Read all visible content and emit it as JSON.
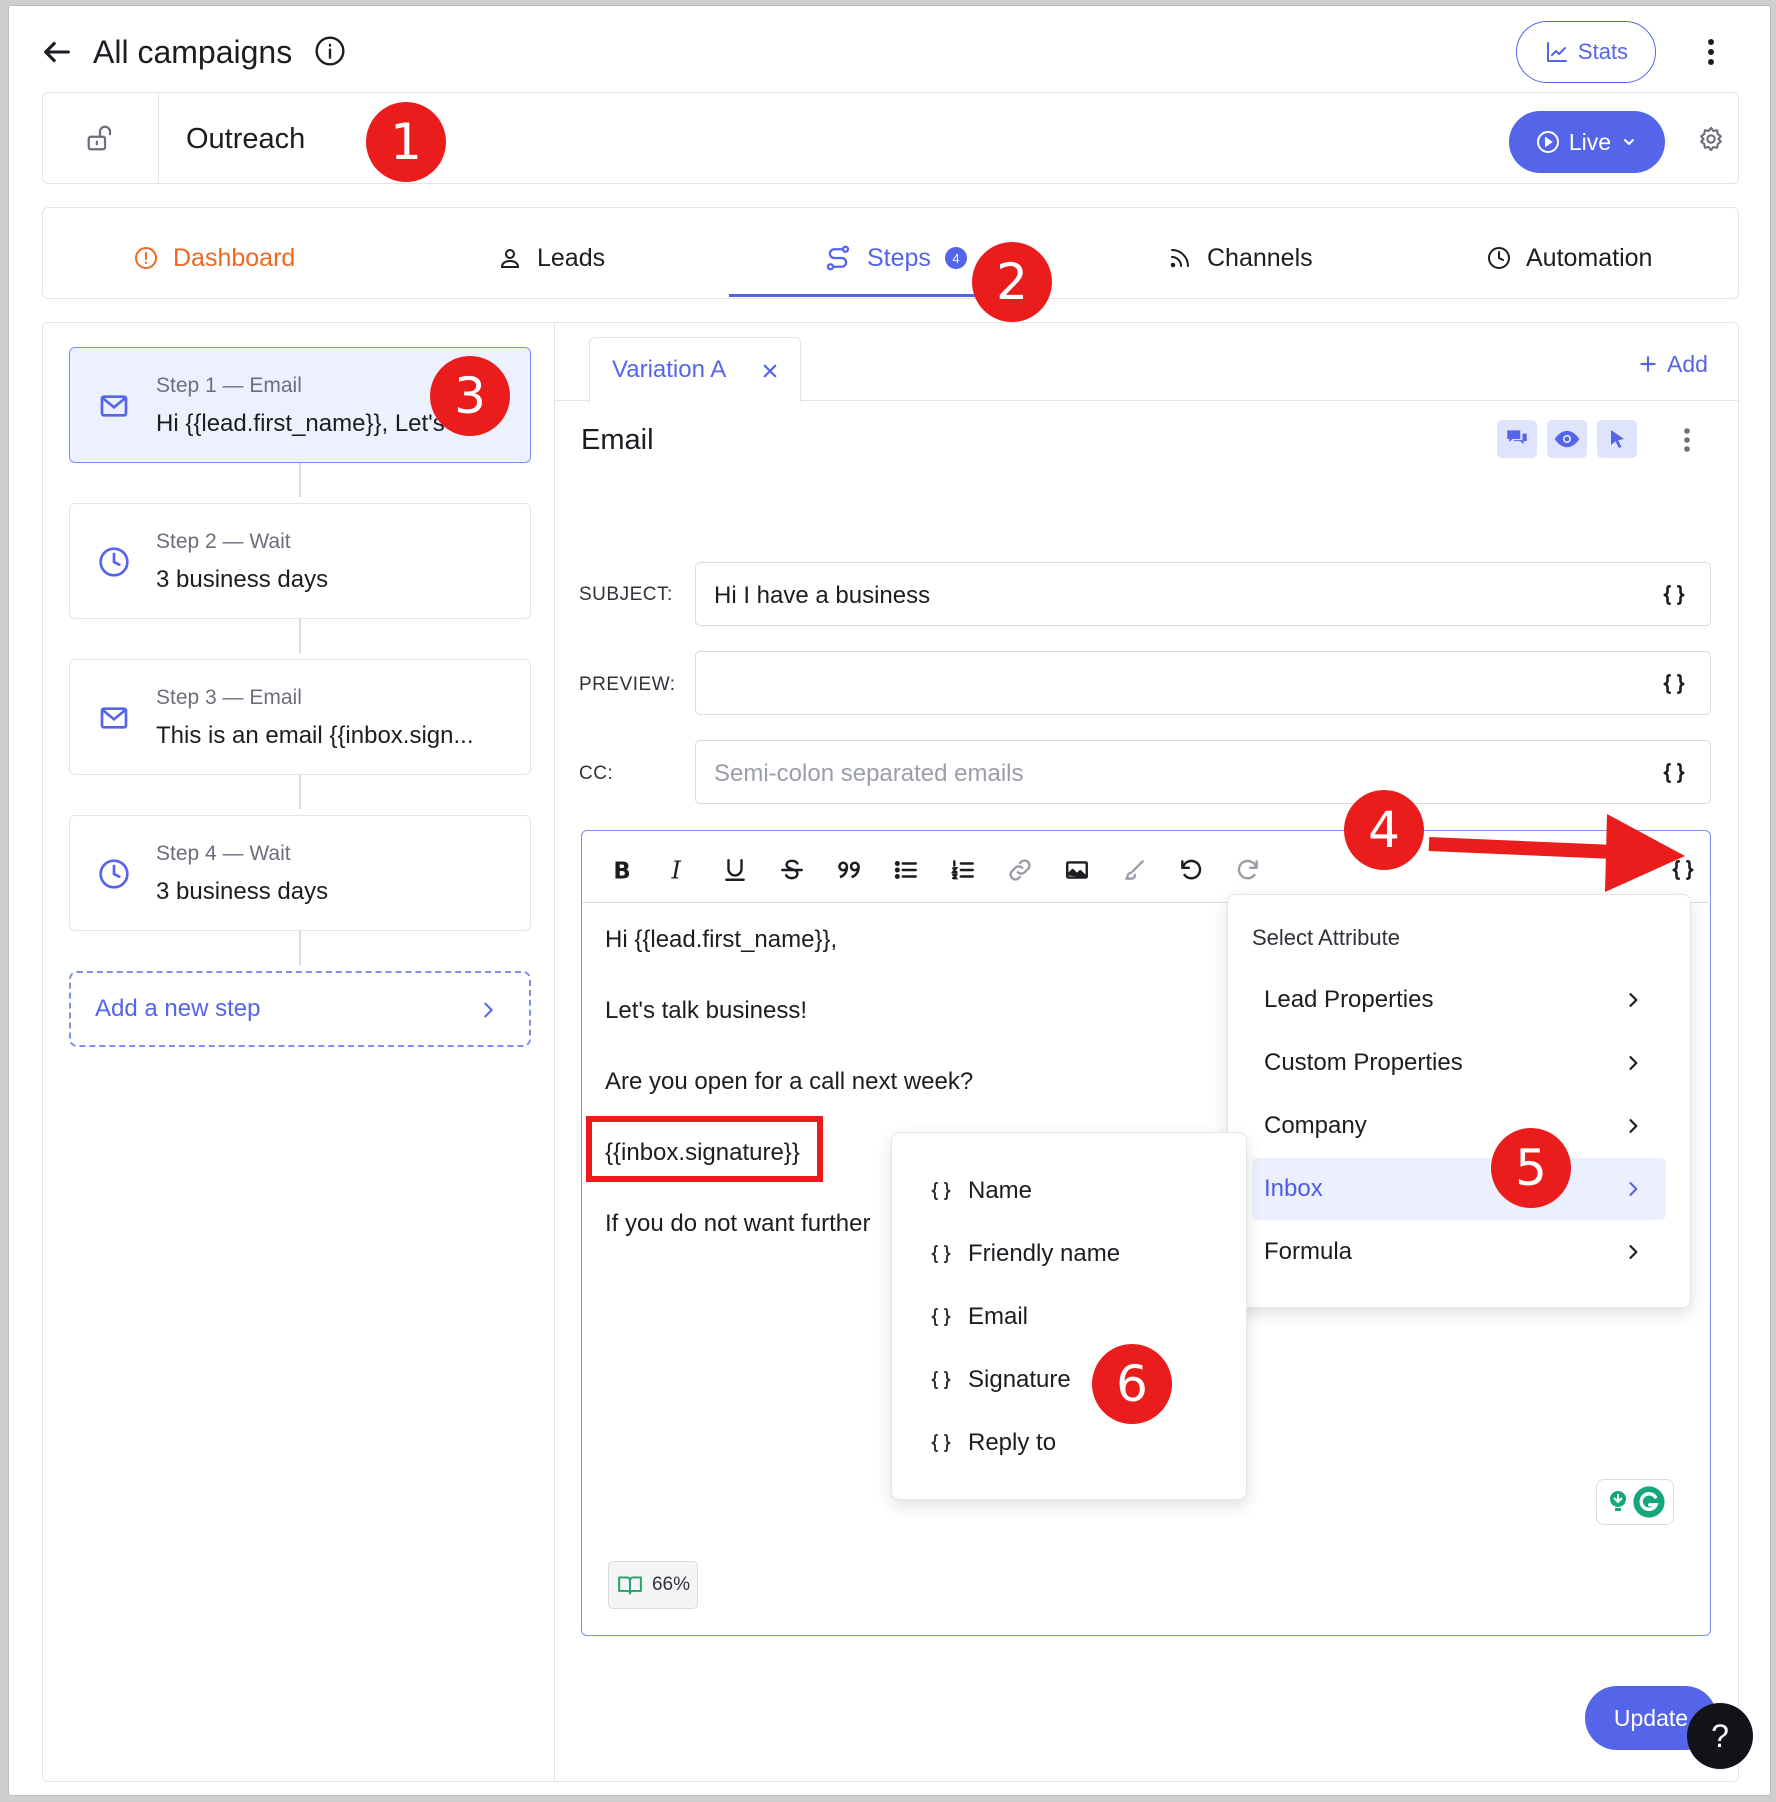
{
  "header": {
    "back_label": "All campaigns",
    "stats_label": "Stats"
  },
  "campaign": {
    "name": "Outreach",
    "status_label": "Live"
  },
  "tabs": [
    {
      "label": "Dashboard"
    },
    {
      "label": "Leads"
    },
    {
      "label": "Steps",
      "badge": "4"
    },
    {
      "label": "Channels"
    },
    {
      "label": "Automation"
    }
  ],
  "steps": [
    {
      "title": "Step 1 — Email",
      "summary": "Hi {{lead.first_name}}, Let's t..."
    },
    {
      "title": "Step 2 — Wait",
      "summary": "3 business days"
    },
    {
      "title": "Step 3 — Email",
      "summary": "This is an email {{inbox.sign..."
    },
    {
      "title": "Step 4 — Wait",
      "summary": "3 business days"
    }
  ],
  "add_step_label": "Add a new step",
  "variation": {
    "label": "Variation A",
    "add_label": "Add"
  },
  "editor": {
    "section_title": "Email",
    "subject_label": "SUBJECT:",
    "subject_value": "Hi I have a business",
    "preview_label": "PREVIEW:",
    "preview_value": "",
    "cc_label": "CC:",
    "cc_placeholder": "Semi-colon separated emails",
    "body": {
      "line1": "Hi {{lead.first_name}},",
      "line2": "Let's talk business!",
      "line3": "Are you open for a call next week?",
      "line4": "{{inbox.signature}}",
      "line5": "If you do not want further"
    },
    "readability": "66%"
  },
  "attribute_menu": {
    "title": "Select Attribute",
    "items": [
      {
        "label": "Lead Properties"
      },
      {
        "label": "Custom Properties"
      },
      {
        "label": "Company"
      },
      {
        "label": "Inbox"
      },
      {
        "label": "Formula"
      }
    ]
  },
  "inbox_submenu": {
    "items": [
      {
        "label": "Name"
      },
      {
        "label": "Friendly name"
      },
      {
        "label": "Email"
      },
      {
        "label": "Signature"
      },
      {
        "label": "Reply to"
      }
    ]
  },
  "update_label": "Update",
  "help_label": "?",
  "markers": [
    "1",
    "2",
    "3",
    "4",
    "5",
    "6"
  ],
  "colors": {
    "accent": "#5465ea",
    "dashboard": "#ef6820",
    "marker": "#ea1c1c",
    "text": "#1c1d22"
  }
}
